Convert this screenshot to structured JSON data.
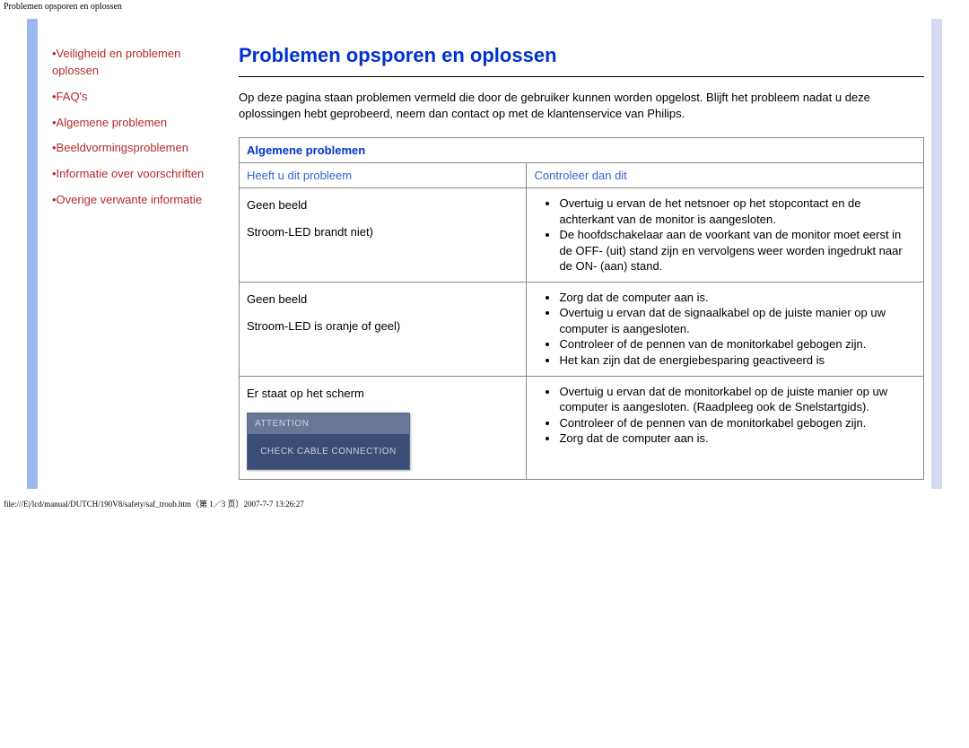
{
  "header_path": "Problemen opsporen en oplossen",
  "page_title": "Problemen opsporen en oplossen",
  "intro": "Op deze pagina staan problemen vermeld die door de gebruiker kunnen worden opgelost. Blijft het probleem nadat u deze oplossingen hebt geprobeerd, neem dan contact op met de klantenservice van Philips.",
  "sidebar": {
    "items": [
      "•Veiligheid en problemen oplossen",
      "•FAQ's",
      "•Algemene problemen",
      "•Beeldvormingsproblemen",
      "•Informatie over voorschriften",
      "•Overige verwante informatie"
    ]
  },
  "table": {
    "section_header": "Algemene problemen",
    "col1": "Heeft u dit probleem",
    "col2": "Controleer dan dit",
    "rows": [
      {
        "problem_line1": "Geen beeld",
        "problem_line2": "Stroom-LED brandt niet)",
        "solutions": [
          "Overtuig u ervan de het netsnoer op het stopcontact en de achterkant van de monitor is aangesloten.",
          "De hoofdschakelaar aan de voorkant van de monitor moet eerst in de OFF- (uit) stand zijn en vervolgens weer worden ingedrukt naar de ON- (aan) stand."
        ]
      },
      {
        "problem_line1": "Geen beeld",
        "problem_line2": "Stroom-LED is oranje of geel)",
        "solutions": [
          "Zorg dat de computer aan is.",
          "Overtuig u ervan dat de signaalkabel op de juiste manier op uw computer is aangesloten.",
          "Controleer of de pennen van de monitorkabel gebogen zijn.",
          "Het kan zijn dat de energiebesparing geactiveerd is"
        ]
      },
      {
        "problem_line1": "Er staat op het scherm",
        "attention_top": "ATTENTION",
        "attention_bot": "CHECK CABLE CONNECTION",
        "solutions": [
          "Overtuig u ervan dat de monitorkabel op de juiste manier op uw computer is aangesloten. (Raadpleeg ook de Snelstartgids).",
          "Controleer of de pennen van de monitorkabel gebogen zijn.",
          "Zorg dat de computer aan is."
        ]
      }
    ]
  },
  "footer_path": "file:///E|/lcd/manual/DUTCH/190V8/safety/saf_troub.htm（第 1／3 页）2007-7-7 13:26:27"
}
